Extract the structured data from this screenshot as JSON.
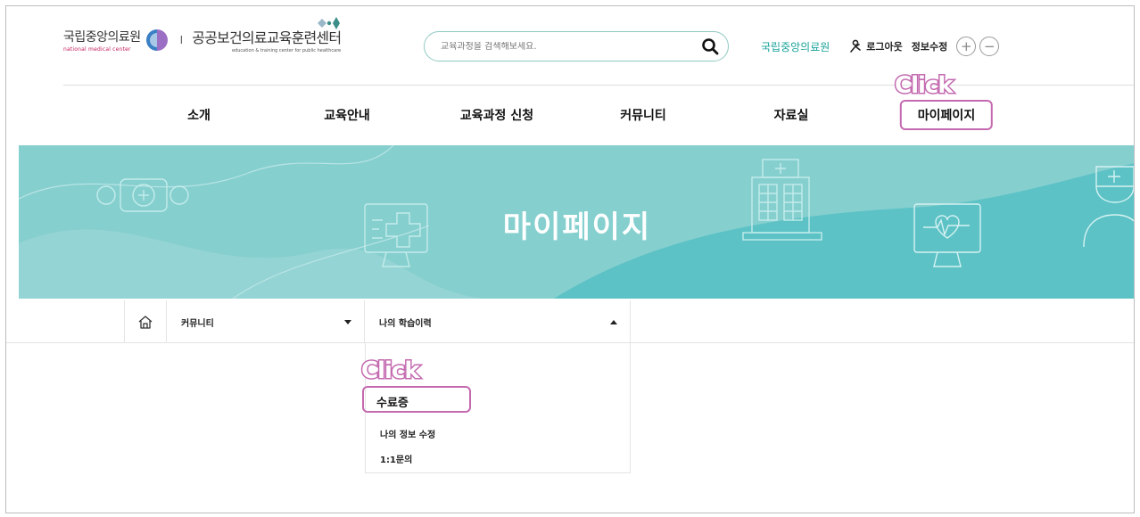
{
  "header": {
    "logo_nmc": "국립중앙의료원",
    "logo_nmc_sub": "national medical center",
    "logo_sep": "I",
    "logo_center": "공공보건의료교육훈련센터",
    "logo_center_sub": "education & training center for public healthcare",
    "search_placeholder": "교육과정을 검색해보세요.",
    "util_nmc": "국립중앙의료원",
    "util_logout": "로그아웃",
    "util_edit": "정보수정",
    "zoom_in": "+",
    "zoom_out": "−"
  },
  "nav": {
    "items": [
      "소개",
      "교육안내",
      "교육과정 신청",
      "커뮤니티",
      "자료실",
      "마이페이지"
    ]
  },
  "annotations": {
    "click_1": "Click",
    "click_2": "Click"
  },
  "banner": {
    "title": "마이페이지"
  },
  "location": {
    "level1": "커뮤니티",
    "level2": "나의 학습이력"
  },
  "dropdown": {
    "items": [
      "수료증",
      "나의 정보 수정",
      "1:1문의"
    ]
  },
  "colors": {
    "accent": "#1aa39a",
    "highlight": "#c46ab0",
    "banner": "#7fcccc"
  }
}
